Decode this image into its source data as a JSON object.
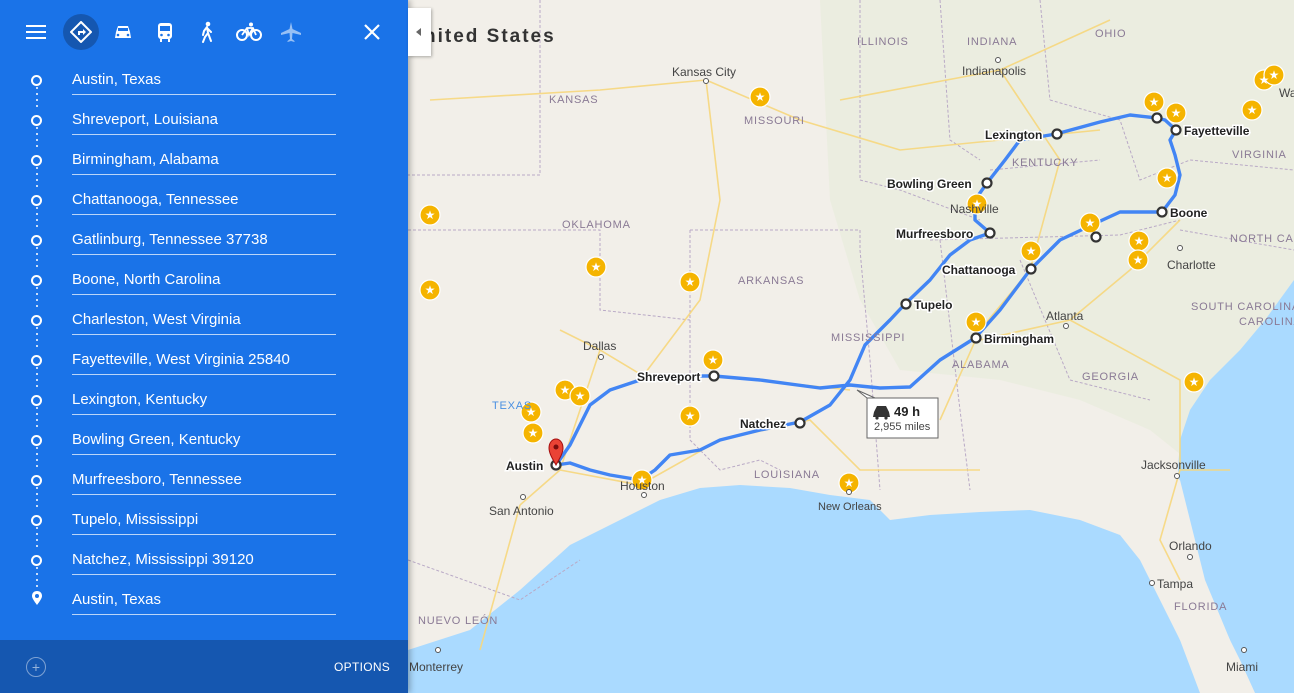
{
  "toolbar": {
    "menu_icon": "menu-icon",
    "modes": [
      {
        "name": "best-route-icon",
        "active": true
      },
      {
        "name": "driving-icon",
        "active": false
      },
      {
        "name": "transit-icon",
        "active": false
      },
      {
        "name": "walking-icon",
        "active": false
      },
      {
        "name": "cycling-icon",
        "active": false
      },
      {
        "name": "flight-icon",
        "active": false
      }
    ],
    "close_icon": "close-icon"
  },
  "waypoints": [
    "Austin, Texas",
    "Shreveport, Louisiana",
    "Birmingham, Alabama",
    "Chattanooga, Tennessee",
    "Gatlinburg, Tennessee 37738",
    "Boone, North Carolina",
    "Charleston, West Virginia",
    "Fayetteville, West Virginia 25840",
    "Lexington, Kentucky",
    "Bowling Green, Kentucky",
    "Murfreesboro, Tennessee",
    "Tupelo, Mississippi",
    "Natchez, Mississippi 39120",
    "Austin, Texas"
  ],
  "bottom": {
    "add_icon": "+",
    "options_label": "OPTIONS"
  },
  "map": {
    "country_label": "nited States",
    "route_summary": {
      "duration": "49 h",
      "distance": "2,955 miles"
    },
    "route_color": "#4285f4",
    "state_labels": [
      "ILLINOIS",
      "INDIANA",
      "OHIO",
      "KANSAS",
      "MISSOURI",
      "KENTUCKY",
      "VIRGINIA",
      "OKLAHOMA",
      "ARKANSAS",
      "NORTH CAROLINA",
      "SOUTH CAROLINA",
      "MISSISSIPPI",
      "ALABAMA",
      "GEORGIA",
      "TEXAS",
      "LOUISIANA",
      "FLORIDA",
      "NUEVO LEÓN"
    ],
    "stop_labels": [
      "Lexington",
      "Fayetteville",
      "Bowling Green",
      "Boone",
      "Murfreesboro",
      "Chattanooga",
      "Tupelo",
      "Birmingham",
      "Shreveport",
      "Natchez",
      "Austin"
    ],
    "city_labels": [
      "Kansas City",
      "Indianapolis",
      "Nashville",
      "Charlotte",
      "Atlanta",
      "Dallas",
      "Houston",
      "San Antonio",
      "New Orleans",
      "Jacksonville",
      "Orlando",
      "Tampa",
      "Miami",
      "Monterrey",
      "Wa"
    ]
  }
}
